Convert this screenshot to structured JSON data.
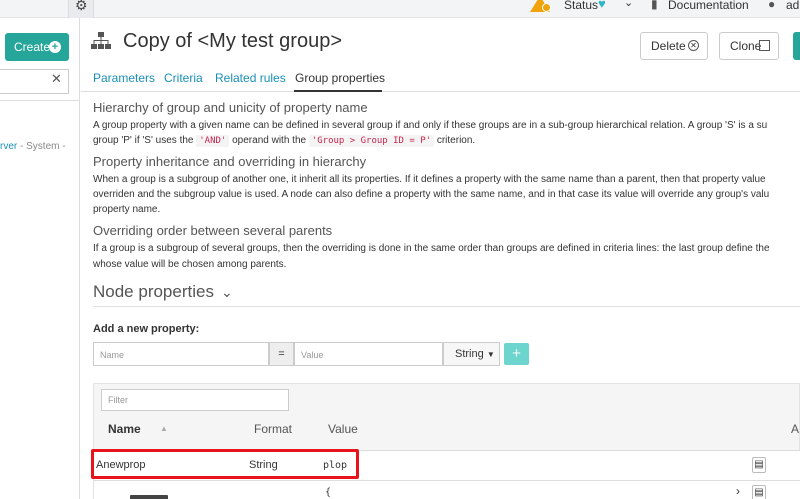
{
  "topbar": {
    "status_label": "Status",
    "documentation_label": "Documentation",
    "user_label": "ad"
  },
  "sidebar": {
    "create_label": "Create",
    "tree_node_name": "rver",
    "tree_node_suffix": " - System -"
  },
  "header": {
    "title": "Copy of <My test group>",
    "delete_label": "Delete",
    "clone_label": "Clone"
  },
  "tabs": [
    {
      "label": "Parameters"
    },
    {
      "label": "Criteria"
    },
    {
      "label": "Related rules"
    },
    {
      "label": "Group properties"
    }
  ],
  "content": {
    "sec1_heading": "Hierarchy of group and unicity of property name",
    "sec1_line1": "A group property with a given name can be defined in several group if and only if these groups are in a sub-group hierarchical relation. A group 'S' is a su",
    "sec1_line2_a": "group 'P' if 'S' uses the ",
    "sec1_code1": "'AND'",
    "sec1_line2_b": " operand with the ",
    "sec1_code2": "'Group > Group ID = P'",
    "sec1_line2_c": " criterion.",
    "sec2_heading": "Property inheritance and overriding in hierarchy",
    "sec2_line1": "When a group is a subgroup of another one, it inherit all its properties. If it defines a property with the same name than a parent, then that property value",
    "sec2_line2": "overriden and the subgroup value is used. A node can also define a property with the same name, and in that case its value will override any group's valu",
    "sec2_line3": "property name.",
    "sec3_heading": "Overriding order between several parents",
    "sec3_line1": "If a group is a subgroup of several groups, then the overriding is done in the same order than groups are defined in criteria lines: the last group define the",
    "sec3_line2": "whose value will be chosen among parents."
  },
  "node_properties": {
    "heading": "Node properties",
    "add_label": "Add a new property:",
    "name_placeholder": "Name",
    "equals": "=",
    "value_placeholder": "Value",
    "type_selected": "String",
    "add_button": "+",
    "filter_placeholder": "Filter",
    "columns": {
      "name": "Name",
      "format": "Format",
      "value": "Value",
      "actions": "A"
    },
    "rows": [
      {
        "name": "Anewprop",
        "format": "String",
        "value": "plop"
      },
      {
        "name": "",
        "format": "",
        "value": "{"
      }
    ]
  },
  "colors": {
    "accent": "#26a69a",
    "link": "#1a8fb5",
    "highlight": "#e8141b"
  }
}
